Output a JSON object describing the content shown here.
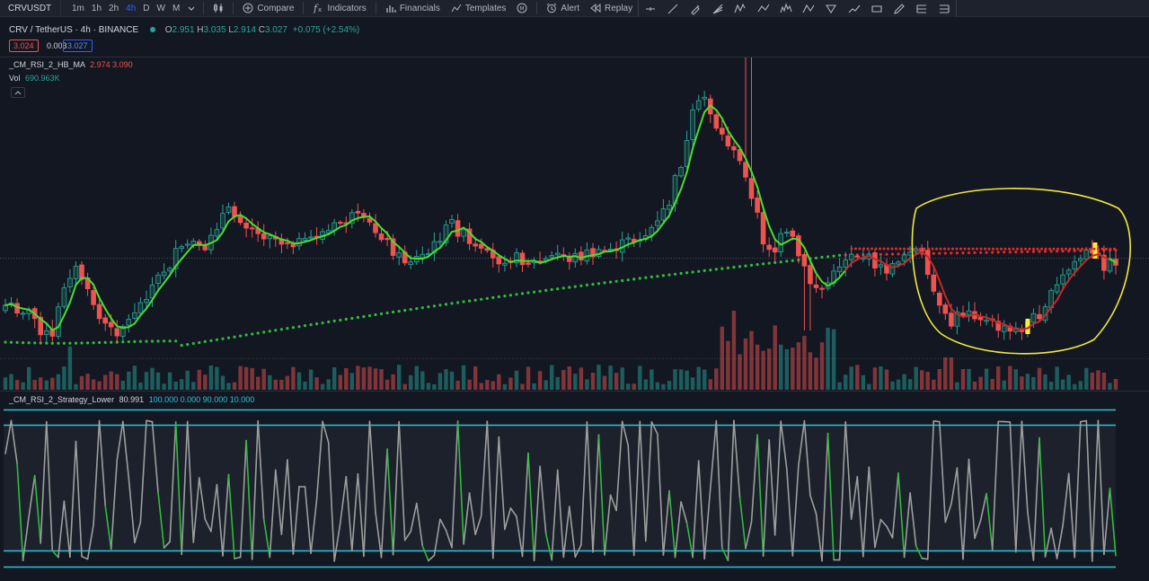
{
  "toolbar": {
    "symbol": "CRVUSDT",
    "intervals": [
      "1m",
      "1h",
      "2h",
      "4h",
      "D",
      "W",
      "M"
    ],
    "active_interval": "4h",
    "compare_label": "Compare",
    "indicators_label": "Indicators",
    "financials_label": "Financials",
    "templates_label": "Templates",
    "alert_label": "Alert",
    "replay_label": "Replay",
    "drawing_tools": [
      "horizontal-ray",
      "trend-line",
      "brush",
      "fib-fan",
      "xabcd",
      "polyline",
      "elliott-wave",
      "abcd",
      "pattern",
      "path",
      "rectangle",
      "pencil",
      "long-position",
      "short-position"
    ]
  },
  "legend": {
    "symbol": "CRV / TetherUS",
    "interval": "4h",
    "exchange": "BINANCE",
    "open_label": "O",
    "open": "2.951",
    "high_label": "H",
    "high": "3.035",
    "low_label": "L",
    "low": "2.914",
    "close_label": "C",
    "close": "3.027",
    "change": "+0.075 (+2.54%)",
    "bid": "3.024",
    "spread": "0.003",
    "ask": "3.027"
  },
  "indicators": {
    "hb_ma": {
      "name": "_CM_RSI_2_HB_MA",
      "v1": "2.974",
      "v2": "3.090"
    },
    "volume": {
      "name": "Vol",
      "value": "690.963K"
    },
    "lower": {
      "name": "_CM_RSI_2_Strategy_Lower",
      "value": "80.991",
      "params": "100.000  0.000  90.000  10.000"
    }
  },
  "colors": {
    "bg": "#131722",
    "toolbar_bg": "#1e222d",
    "up": "#26a69a",
    "down": "#ef5350",
    "ma_up": "#4ddc2e",
    "ma_down": "#c62828",
    "sma_dots": "#2ebd3a",
    "red_dots": "#e52a2a",
    "rsi_line": "#9e9e9e",
    "rsi_bands": "#26c6da",
    "annotation": "#f2e93a",
    "active": "#2962ff"
  },
  "chart_data": {
    "type": "candlestick",
    "symbol": "CRV / TetherUS",
    "interval": "4h",
    "exchange": "BINANCE",
    "main_pane": {
      "candles_approx_count": 185,
      "last_candle": {
        "open": 2.951,
        "high": 3.035,
        "low": 2.914,
        "close": 3.027
      },
      "series": [
        "price candles",
        "_CM_RSI_2_HB_MA",
        "long moving average (dotted)",
        "Vol"
      ]
    },
    "lower_pane": {
      "name": "_CM_RSI_2_Strategy_Lower",
      "value": 80.991,
      "levels": [
        100,
        90,
        10,
        0
      ]
    }
  }
}
